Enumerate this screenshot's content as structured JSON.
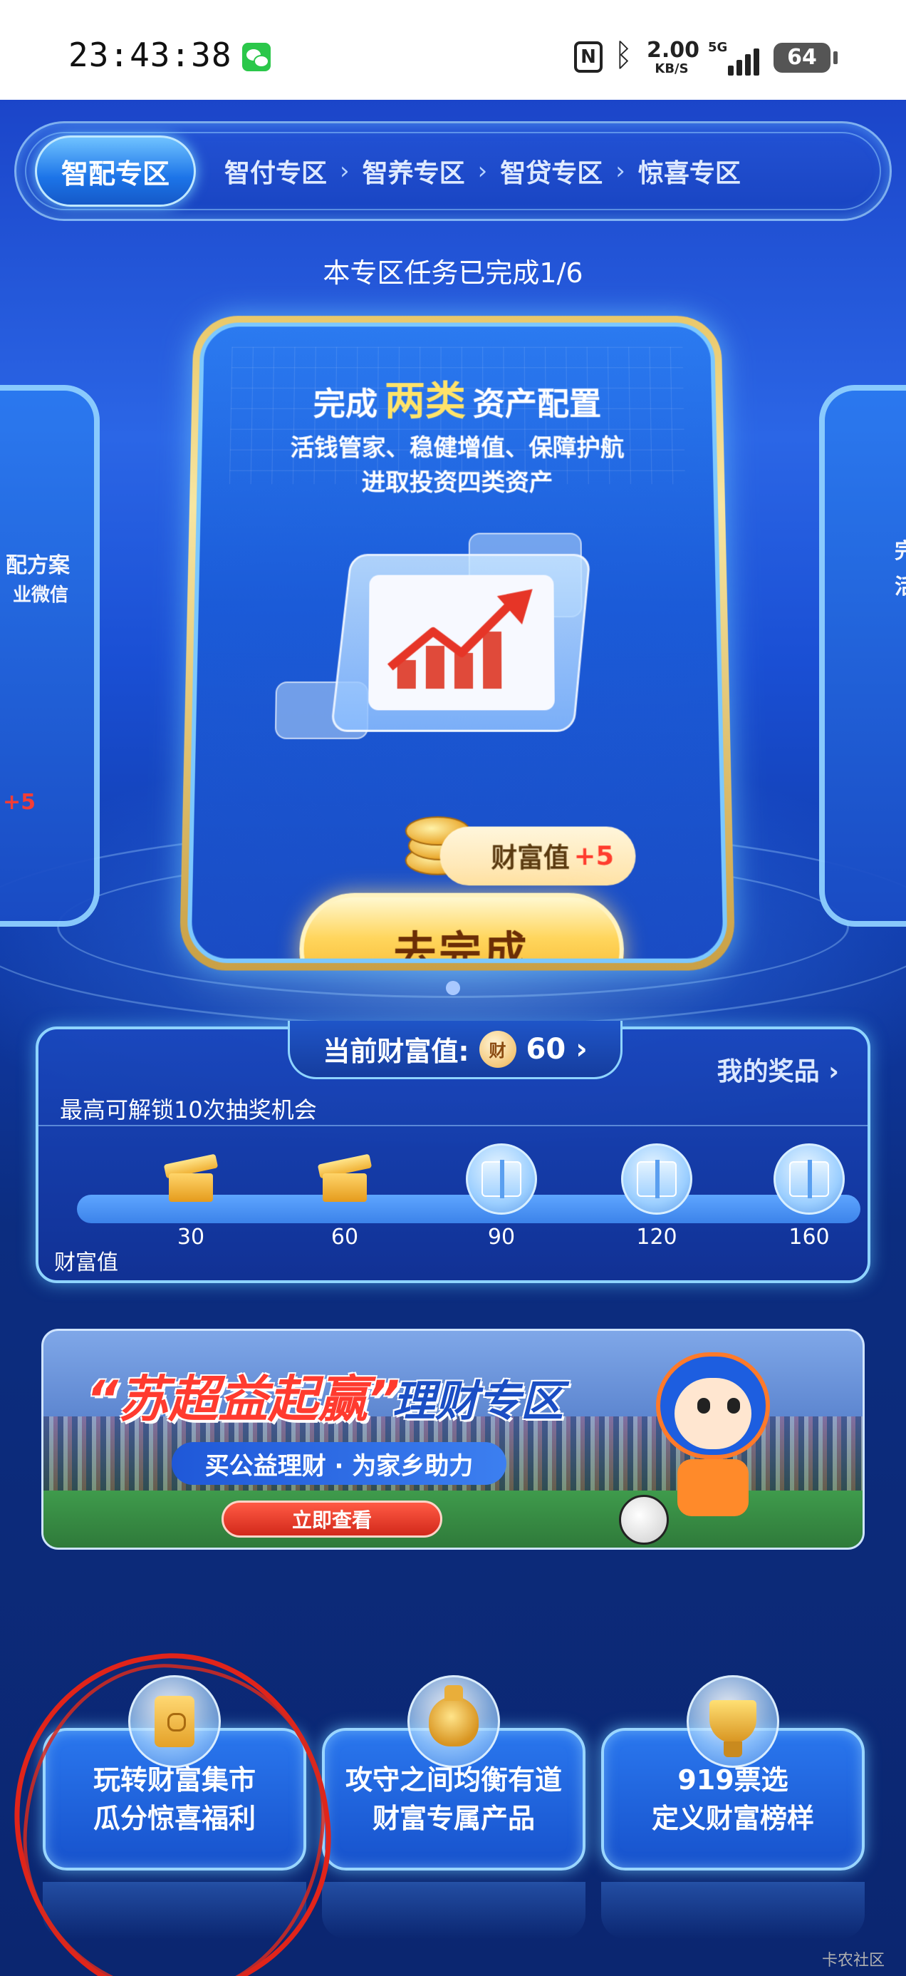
{
  "status_bar": {
    "time": "23:43:38",
    "network_speed_value": "2.00",
    "network_speed_unit": "KB/S",
    "network_type": "5G",
    "battery": "64"
  },
  "tabs": [
    {
      "label": "智配专区",
      "active": true
    },
    {
      "label": "智付专区",
      "active": false
    },
    {
      "label": "智养专区",
      "active": false
    },
    {
      "label": "智贷专区",
      "active": false
    },
    {
      "label": "惊喜专区",
      "active": false
    }
  ],
  "tab_separator": "›",
  "zone_progress": "本专区任务已完成1/6",
  "task_card": {
    "title_prefix": "完成",
    "title_highlight": "两类",
    "title_suffix": "资产配置",
    "desc_line1": "活钱管家、稳健增值、保障护航",
    "desc_line2": "进取投资四类资产",
    "reward_label": "财富值",
    "reward_value": "+5",
    "cta_label": "去完成"
  },
  "side_cards": {
    "left_line1": "配方案",
    "left_line2": "业微信",
    "left_reward": "+5",
    "right_line1": "完",
    "right_line2": "活"
  },
  "wealth": {
    "title": "当前财富值:",
    "coin_glyph": "财",
    "value": "60",
    "chevron": "›",
    "my_prizes": "我的奖品 ›",
    "unlock_text": "最高可解锁10次抽奖机会",
    "axis_label": "财富值",
    "milestones": [
      {
        "value": "30",
        "state": "opened"
      },
      {
        "value": "60",
        "state": "opened"
      },
      {
        "value": "90",
        "state": "locked"
      },
      {
        "value": "120",
        "state": "locked"
      },
      {
        "value": "160",
        "state": "locked"
      }
    ]
  },
  "banner": {
    "title_main": "“苏超益起赢”",
    "title_suffix": "理财专区",
    "subtitle": "买公益理财 · 为家乡助力",
    "button": "立即查看"
  },
  "features": [
    {
      "line1": "玩转财富集市",
      "line2": "瓜分惊喜福利",
      "icon": "envelope-icon"
    },
    {
      "line1": "攻守之间均衡有道",
      "line2": "财富专属产品",
      "icon": "money-bag-icon"
    },
    {
      "line1": "919票选",
      "line2": "定义财富榜样",
      "icon": "trophy-icon"
    }
  ],
  "watermark": "卡农社区"
}
